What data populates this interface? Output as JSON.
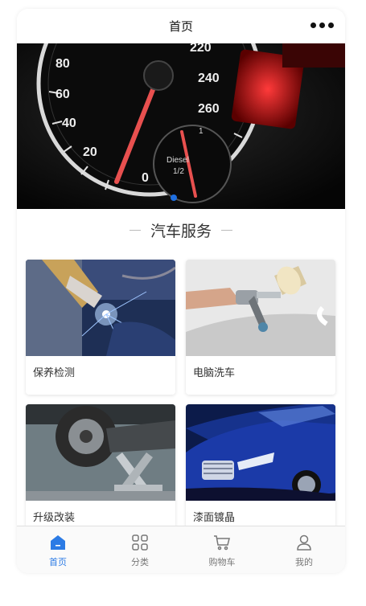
{
  "nav": {
    "title": "首页"
  },
  "section": {
    "title": "汽车服务"
  },
  "services": [
    {
      "label": "保养检测"
    },
    {
      "label": "电脑洗车"
    },
    {
      "label": "升级改装"
    },
    {
      "label": "漆面镀晶"
    }
  ],
  "banner": {
    "gauge_numbers": [
      "80",
      "60",
      "40",
      "20",
      "0",
      "220",
      "240",
      "260"
    ],
    "gauge_text": [
      "Diesel",
      "1/2",
      "1"
    ],
    "slides": 1,
    "active_slide": 1
  },
  "tabs": [
    {
      "label": "首页",
      "icon": "home-icon",
      "active": true
    },
    {
      "label": "分类",
      "icon": "grid-icon",
      "active": false
    },
    {
      "label": "购物车",
      "icon": "cart-icon",
      "active": false
    },
    {
      "label": "我的",
      "icon": "user-icon",
      "active": false
    }
  ],
  "colors": {
    "accent": "#2c7be5",
    "indicator": "#1f6fe0"
  }
}
